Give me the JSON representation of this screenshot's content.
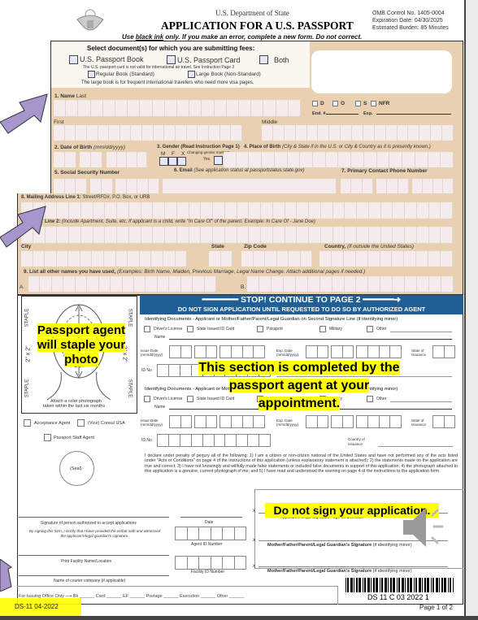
{
  "header": {
    "dept": "U.S. Department of State",
    "title": "APPLICATION FOR A U.S. PASSPORT",
    "omb": "OMB Control No. 1405-0004",
    "expiration": "Expiration Date: 04/30/2025",
    "burden": "Estimated Burden: 85 Minutes",
    "instruction_pre": "Use ",
    "instruction_ul": "black ink",
    "instruction_post": " only. If you make an error, complete a new form. Do not correct."
  },
  "fees": {
    "title": "Select document(s) for which you are submitting fees:",
    "book": "U.S. Passport Book",
    "card": "U.S. Passport Card",
    "both": "Both",
    "card_note": "The U.S. passport card is not valid for international air travel. See Instruction Page 3",
    "regular": "Regular Book (Standard)",
    "large": "Large Book (Non-Standard)",
    "large_note": "The large book is for frequent international travelers who need more visa pages."
  },
  "office": {
    "d": "D",
    "o": "O",
    "s": "S",
    "nfr": "NFR",
    "end": "End. #",
    "exp": "Exp."
  },
  "fields": {
    "name": "1. Name",
    "last": "Last",
    "first": "First",
    "middle": "Middle",
    "dob": "2. Date of Birth",
    "dob_fmt": "(mm/dd/yyyy)",
    "gender": "3. Gender (Read Instruction Page 1)",
    "pob": "4. Place of Birth",
    "pob_note": "(City & State if in the U.S. or City & Country as it is presently known.)",
    "m": "M",
    "f": "F",
    "x": "X",
    "changing": "Changing gender marker?",
    "yes": "Yes",
    "ssn": "5. Social Security Number",
    "email": "6. Email",
    "email_note": "(See application status at passportstatus.state.gov)",
    "phone": "7. Primary Contact Phone Number",
    "addr1": "8. Mailing Address Line 1:",
    "addr1_note": "Street/RFD#, P.O. Box, or URB",
    "addr2": "Line 2:",
    "addr2_note": "(Include Apartment, Suite, etc. If applicant is a child, write \"In Care Of\" of the parent. Example: In Care Of - Jane Doe)",
    "city": "City",
    "state": "State",
    "zip": "Zip Code",
    "country": "Country,",
    "country_note": "(if outside the United States)",
    "other_names": "9. List all other names you have used,",
    "other_names_note": "(Examples: Birth Name, Maiden, Previous Marriage, Legal Name Change. Attach additional pages if needed.)",
    "a": "A.",
    "b": "B."
  },
  "photo": {
    "staple": "STAPLE",
    "size": "2\" x 2\"",
    "attach1": "Attach a color photograph",
    "attach2": "taken within the last six months"
  },
  "banner": {
    "line1": "STOP! CONTINUE TO PAGE 2",
    "line2": "DO NOT SIGN APPLICATION UNTIL REQUESTED TO DO SO BY AUTHORIZED AGENT"
  },
  "agent": {
    "id_docs": "Identifying Documents - Applicant or Mother/Father/Parent/Legal Guardian on Second Signature Line (if identifying minor)",
    "dl": "Driver's License",
    "state_id": "State Issued ID Card",
    "passport": "Passport",
    "military": "Military",
    "other": "Other",
    "name": "Name",
    "issue": "Issue Date (mm/dd/yyyy)",
    "exp": "Exp. Date (mm/dd/yyyy)",
    "state_iss": "State of Issuance",
    "id_no": "ID No",
    "country_iss": "Country of Issuance",
    "acceptance": "Acceptance Agent",
    "consul": "(Vice) Consul USA",
    "staff": "Passport Staff Agent",
    "seal": "(Seal)",
    "declaration": "I declare under penalty of perjury all of the following: 1) I am a citizen or non-citizen national of the United States and have not performed any of the acts listed under \"Acts or Conditions\" on page 4 of the instructions of this application (unless explanatory statement is attached); 2) the statements made on the application are true and correct; 3) I have not knowingly and willfully made false statements or included false documents in support of this application; 4) the photograph attached to this application is a genuine, current photograph of me; and 5) I have read and understood the warning on page 4 of the instructions to the application form.",
    "sig_person": "Signature of person authorized to accept applications",
    "oath": "By signing this form, I certify that I have provided the verbal oath and witnessed the applicant's/legal guardian's signature.",
    "date": "Date",
    "agent_id": "Agent ID Number",
    "facility": "Print Facility Name/Location",
    "facility_id": "Facility ID Number",
    "courier": "Name of courier company (if applicable)",
    "x": "x",
    "applicant_sig": "Applicant's Legal Signature - age 16 and older",
    "guardian_sig": "Mother/Father/Parent/Legal Guardian's Signature",
    "guardian_note": "(if identifying minor)"
  },
  "footer": {
    "office_only": "For Issuing Office Only",
    "bk": "Bk",
    "card": "Card",
    "ef": "EF",
    "postage": "Postage",
    "execution": "Execution",
    "other": "Other",
    "barcode": "DS 11 C 03 2022 1",
    "form_id": "DS-11 04-2022",
    "page": "Page 1 of 2"
  },
  "annotations": {
    "photo": "Passport agent will staple your photo",
    "section": "This section is completed by the passport agent at your appointment.",
    "nosign": "Do not sign your application."
  },
  "icons": {
    "seal": "us-seal-icon",
    "speaker": "speaker-icon",
    "arrow": "arrow-icon"
  },
  "colors": {
    "tan": "#e8d0b0",
    "banner": "#1f5f95",
    "highlight": "#ffff00",
    "arrow": "#a696cc"
  }
}
